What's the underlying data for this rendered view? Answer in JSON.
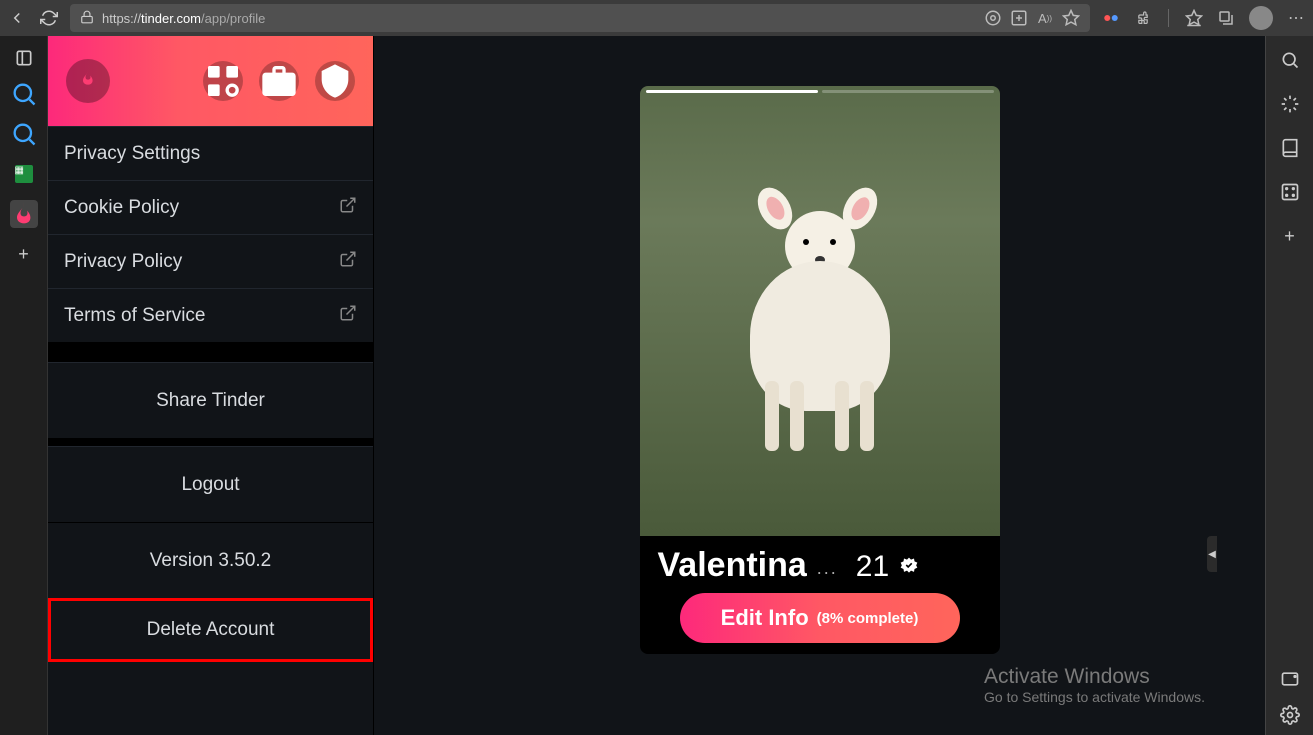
{
  "browser": {
    "url_prefix": "https://",
    "url_domain": "tinder.com",
    "url_path": "/app/profile"
  },
  "sidebar": {
    "items": [
      {
        "label": "Privacy Settings",
        "external": false
      },
      {
        "label": "Cookie Policy",
        "external": true
      },
      {
        "label": "Privacy Policy",
        "external": true
      },
      {
        "label": "Terms of Service",
        "external": true
      }
    ],
    "share_label": "Share Tinder",
    "logout_label": "Logout",
    "version_label": "Version 3.50.2",
    "delete_label": "Delete Account"
  },
  "profile": {
    "name": "Valentina",
    "age": "21",
    "edit_label": "Edit Info",
    "edit_complete": "(8% complete)",
    "photo_segments": 2,
    "active_segment": 0
  },
  "activate": {
    "title": "Activate Windows",
    "sub": "Go to Settings to activate Windows."
  }
}
